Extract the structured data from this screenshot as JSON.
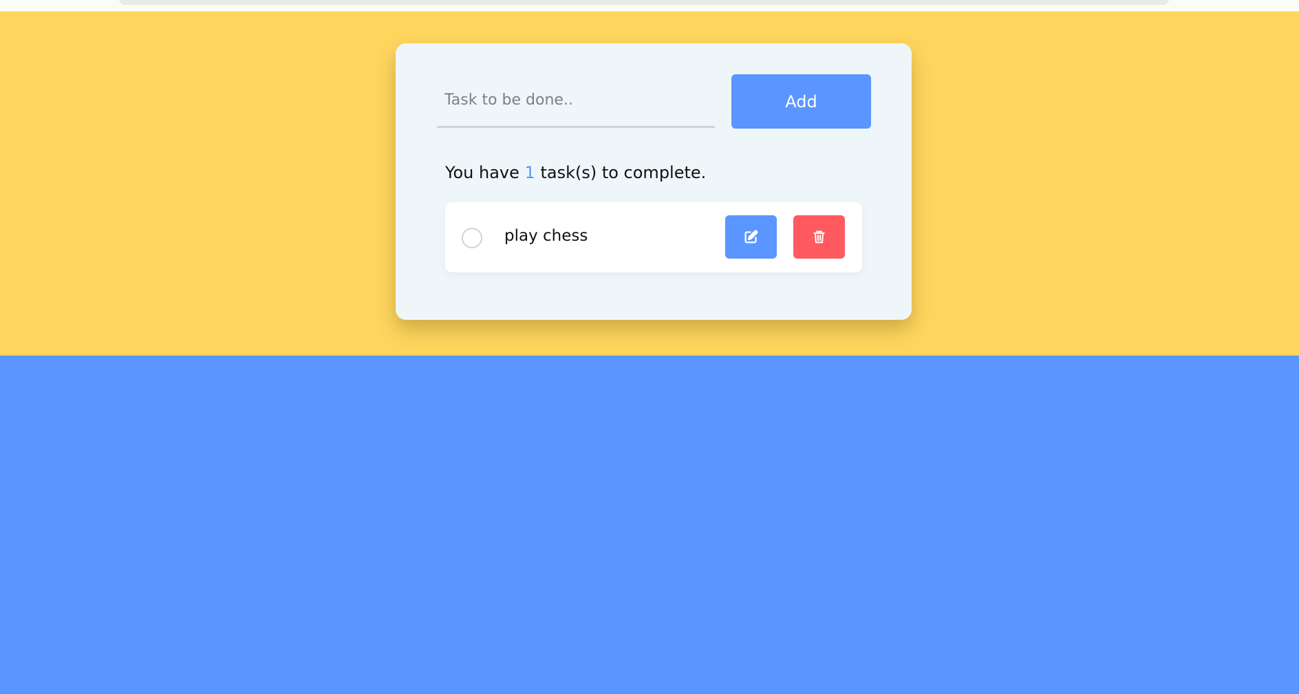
{
  "colors": {
    "accent_blue": "#5b95ff",
    "yellow_background": "#fed65e",
    "delete_red": "#ff5a5f",
    "card_background": "#eff6fa"
  },
  "form": {
    "input_placeholder": "Task to be done..",
    "input_value": "",
    "add_label": "Add"
  },
  "summary": {
    "prefix": "You have",
    "count": "1",
    "suffix": "task(s) to complete."
  },
  "tasks": [
    {
      "text": "play chess",
      "completed": false,
      "edit_icon": "edit-icon",
      "delete_icon": "trash-icon"
    }
  ]
}
